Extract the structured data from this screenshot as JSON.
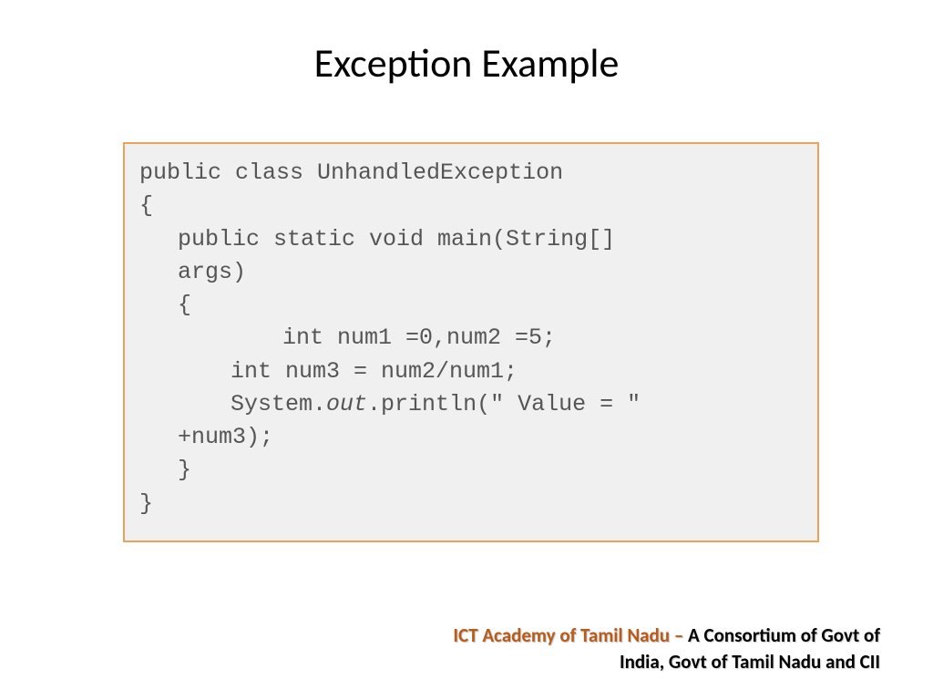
{
  "title": "Exception Example",
  "code": {
    "l1": "public class UnhandledException",
    "l2": "{",
    "l3a": "public static void main(String[]",
    "l3b": "args)",
    "l4": "{",
    "l5": " int num1 =0,num2 =5;",
    "l6": "int num3 = num2/num1;",
    "l7a": "System.",
    "l7b": "out",
    "l7c": ".println(\" Value = \"",
    "l7d": "+num3);",
    "l8": "}",
    "l9": "}"
  },
  "footer": {
    "org": "ICT Academy of Tamil Nadu – ",
    "rest1": "A Consortium of Govt of",
    "rest2": "India, Govt of Tamil Nadu and CII"
  }
}
